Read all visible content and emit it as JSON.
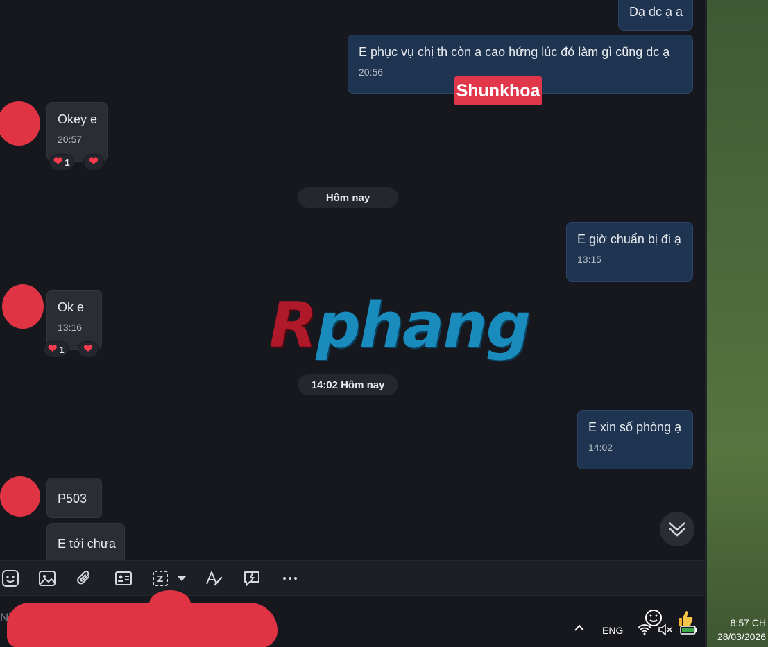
{
  "messages": [
    {
      "text": "Dạ dc ạ a"
    },
    {
      "text": "E phục vụ chị th còn a cao hứng lúc đó làm gì cũng dc ạ",
      "time": "20:56"
    },
    {
      "text": "Okey e",
      "time": "20:57",
      "reaction_count": "1"
    },
    {
      "text": "E giờ chuẩn bị đi ạ",
      "time": "13:15"
    },
    {
      "text": "Ok e",
      "time": "13:16",
      "reaction_count": "1"
    },
    {
      "text": "E xin số phòng ạ",
      "time": "14:02"
    },
    {
      "text": "P503"
    },
    {
      "text": "E tới chưa"
    }
  ],
  "dividers": [
    "Hôm nay",
    "14:02 Hôm nay"
  ],
  "overlays": {
    "sticker": "Shunkhoa",
    "watermark_first": "R",
    "watermark_rest": "phang"
  },
  "colors": {
    "outgoing_bubble": "#1f3451",
    "incoming_bubble": "#2a2d34",
    "avatar": "#e03444",
    "heart": "#ff3b4e"
  },
  "toolbar": {
    "icons": [
      "sticker-icon",
      "image-icon",
      "attach-icon",
      "contact-card-icon",
      "screenshot-icon",
      "format-text-icon",
      "quick-message-icon",
      "more-icon"
    ]
  },
  "composer": {
    "placeholder": "Nh"
  },
  "taskbar": {
    "language": "ENG",
    "time": "8:57 CH",
    "date": "28/03/2026"
  }
}
